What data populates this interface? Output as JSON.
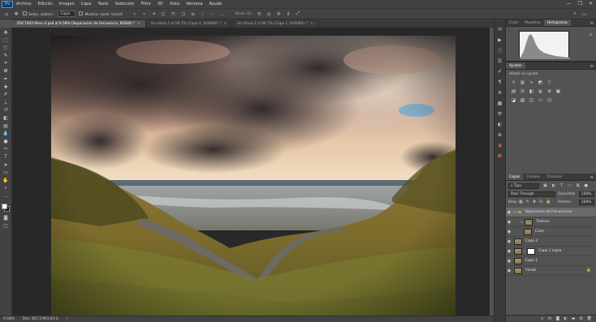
{
  "menubar": {
    "logo": "Ps",
    "items": [
      "Archivo",
      "Edición",
      "Imagen",
      "Capa",
      "Texto",
      "Selección",
      "Filtro",
      "3D",
      "Vista",
      "Ventana",
      "Ayuda"
    ],
    "window_controls": [
      "—",
      "❐",
      "✕"
    ]
  },
  "options_bar": {
    "auto_select_label": "Selec. autom.:",
    "auto_select_value": "Capa",
    "transform_controls_label": "Mostrar contr. transf.",
    "mode_3d_label": "Modo 3D:"
  },
  "tabs": [
    {
      "label": "DSC7462-Pano-3.psd al 9,58% (Separacion de Frecuencia, RGB/8) *",
      "active": true
    },
    {
      "label": "Sin título-1 al 66,7% (Capa 4, RGB/8#) *",
      "active": false
    },
    {
      "label": "Sin título-2 al 66,7% (Capa 1, RGB/8#) *",
      "active": false
    }
  ],
  "status_bar": {
    "zoom": "9,58%",
    "doc_info": "Doc: 367,5 M/1,63 G"
  },
  "histogram_panel": {
    "tabs": [
      "Color",
      "Muestras",
      "Histograma"
    ],
    "active_tab": "Histograma"
  },
  "adjustments_panel": {
    "tab": "Ajustes",
    "subtitle": "Añadir un ajuste"
  },
  "layers_panel": {
    "tabs": [
      "Capas",
      "Canales",
      "Trazados"
    ],
    "active_tab": "Capas",
    "filter_label": "Tipo",
    "blend_mode": "Pass Through",
    "opacity_label": "Opacidad:",
    "opacity_value": "100%",
    "lock_label": "Bloq.:",
    "fill_label": "Relleno:",
    "fill_value": "100%",
    "layers": [
      {
        "name": "Separacion de Frecuencias",
        "kind": "group"
      },
      {
        "name": "Textura",
        "kind": "layer",
        "clipped": true
      },
      {
        "name": "Color",
        "kind": "layer",
        "clipped": false
      },
      {
        "name": "Capa 2",
        "kind": "layer",
        "clipped": false
      },
      {
        "name": "Capa 1 copia",
        "kind": "layer-mask",
        "clipped": false
      },
      {
        "name": "Capa 1",
        "kind": "layer",
        "clipped": false
      },
      {
        "name": "Fondo",
        "kind": "background",
        "clipped": false
      }
    ],
    "bottom_icons": [
      "link-icon",
      "fx-icon",
      "mask-icon",
      "adjustment-icon",
      "folder-icon",
      "new-layer-icon",
      "trash-icon"
    ]
  },
  "colors": {
    "accent": "#31a8ff",
    "selected_row": "#6a6a6a"
  }
}
